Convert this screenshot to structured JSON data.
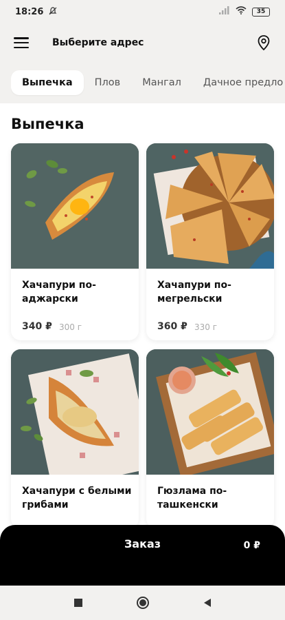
{
  "status": {
    "time": "18:26",
    "battery": "35"
  },
  "header": {
    "address_label": "Выберите адрес"
  },
  "tabs": [
    {
      "label": "Выпечка",
      "active": true
    },
    {
      "label": "Плов",
      "active": false
    },
    {
      "label": "Мангал",
      "active": false
    },
    {
      "label": "Дачное предло",
      "active": false
    }
  ],
  "section": {
    "title": "Выпечка"
  },
  "products": [
    {
      "name": "Хачапури по-аджарски",
      "price": "340 ₽",
      "weight": "300 г"
    },
    {
      "name": "Хачапури по-мегрельски",
      "price": "360 ₽",
      "weight": "330 г"
    },
    {
      "name": "Хачапури с белыми грибами",
      "price": "",
      "weight": ""
    },
    {
      "name": "Гюзлама по-ташкенски",
      "price": "",
      "weight": ""
    }
  ],
  "order": {
    "label": "Заказ",
    "sum": "0 ₽"
  },
  "icons": {
    "menu": "hamburger-icon",
    "location": "map-pin-icon",
    "nav_recent": "square-icon",
    "nav_home": "circle-icon",
    "nav_back": "triangle-back-icon"
  },
  "colors": {
    "accent": "#000000",
    "background": "#f2f1ef",
    "card": "#ffffff"
  }
}
